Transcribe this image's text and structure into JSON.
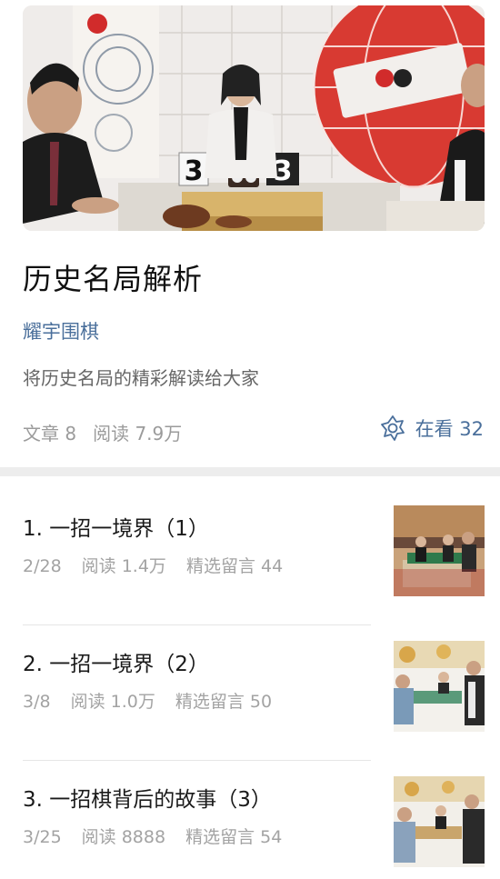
{
  "cover": {
    "score_left": "3",
    "score_right": "3"
  },
  "header": {
    "title": "历史名局解析",
    "author": "耀宇围棋",
    "description": "将历史名局的精彩解读给大家",
    "articles_label": "文章 8",
    "reads_label": "阅读 7.9万",
    "watching_label": "在看 32"
  },
  "articles": [
    {
      "title": "1. 一招一境界（1）",
      "date": "2/28",
      "reads": "阅读 1.4万",
      "comments": "精选留言 44"
    },
    {
      "title": "2. 一招一境界（2）",
      "date": "3/8",
      "reads": "阅读 1.0万",
      "comments": "精选留言 50"
    },
    {
      "title": "3. 一招棋背后的故事（3）",
      "date": "3/25",
      "reads": "阅读 8888",
      "comments": "精选留言 54"
    }
  ],
  "colors": {
    "link_blue": "#4a6f9b",
    "meta_gray": "#a3a3a3",
    "title_black": "#111111"
  },
  "icons": {
    "watching": "flower-icon"
  }
}
